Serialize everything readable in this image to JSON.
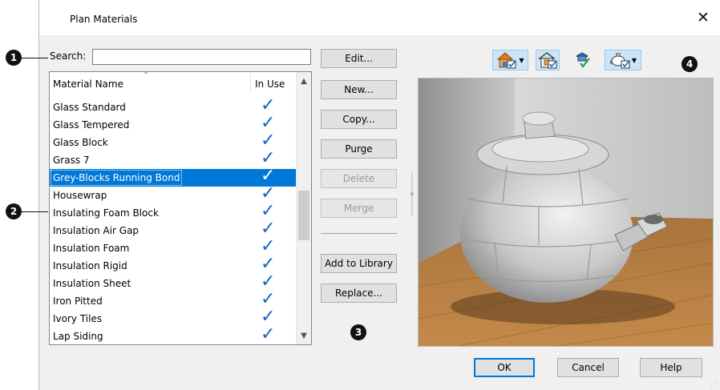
{
  "dialog": {
    "title": "Plan Materials",
    "close_glyph": "✕"
  },
  "callouts": [
    "1",
    "2",
    "3",
    "4"
  ],
  "search": {
    "label": "Search:",
    "value": "",
    "placeholder": ""
  },
  "list": {
    "headers": {
      "name": "Material Name",
      "in_use": "In Use"
    },
    "check_glyph": "✓",
    "rows": [
      {
        "name": "Glass  Standard",
        "in_use": true
      },
      {
        "name": "Glass  Tempered",
        "in_use": true
      },
      {
        "name": "Glass Block",
        "in_use": true
      },
      {
        "name": "Grass 7",
        "in_use": true
      },
      {
        "name": "Grey-Blocks Running Bond",
        "in_use": true,
        "selected": true
      },
      {
        "name": "Housewrap",
        "in_use": true
      },
      {
        "name": "Insulating Foam Block",
        "in_use": true
      },
      {
        "name": "Insulation  Air Gap",
        "in_use": true
      },
      {
        "name": "Insulation  Foam",
        "in_use": true
      },
      {
        "name": "Insulation  Rigid",
        "in_use": true
      },
      {
        "name": "Insulation  Sheet",
        "in_use": true
      },
      {
        "name": "Iron Pitted",
        "in_use": true
      },
      {
        "name": "Ivory Tiles",
        "in_use": true
      },
      {
        "name": "Lap Siding",
        "in_use": true
      }
    ]
  },
  "buttons": {
    "edit": "Edit...",
    "new": "New...",
    "copy": "Copy...",
    "purge": "Purge",
    "delete": "Delete",
    "merge": "Merge",
    "add_to_library": "Add to Library",
    "replace": "Replace..."
  },
  "footer": {
    "ok": "OK",
    "cancel": "Cancel",
    "help": "Help"
  },
  "toolbar": {
    "icons": [
      "house-view-icon",
      "house-dropdown-arrow-icon",
      "room-view-icon",
      "material-check-icon",
      "teapot-view-icon",
      "teapot-dropdown-arrow-icon"
    ]
  },
  "colors": {
    "selection": "#0078d7",
    "check": "#1565c0",
    "toolbar_highlight": "#cce4f7"
  }
}
